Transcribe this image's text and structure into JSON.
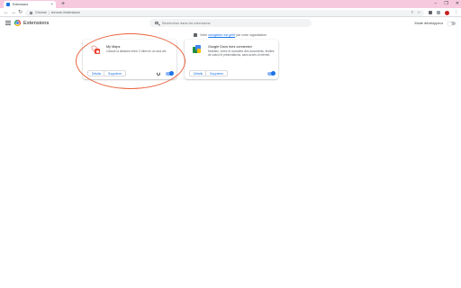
{
  "browser": {
    "tab_title": "Extensions",
    "tab_close": "×",
    "new_tab": "+",
    "window_controls": [
      "–",
      "❐",
      "✕"
    ],
    "omnibox": {
      "site_label": "Chrome",
      "separator": "|",
      "url": "chrome://extensions"
    }
  },
  "header": {
    "title": "Extensions",
    "search_placeholder": "Rechercher dans les extensions",
    "developer_mode_label": "Mode développeur",
    "developer_mode_on": false
  },
  "managed_notice": {
    "before": "Votre",
    "link": "navigateur est géré",
    "after": "par votre organisation"
  },
  "extensions": [
    {
      "name": "My Maps",
      "description": "Calcule la distance entre 2 villes en un seul clic",
      "details_label": "Détails",
      "remove_label": "Supprimer",
      "enabled": true,
      "icon": "map-pin-icon"
    },
    {
      "name": "Google Docs hors connexion",
      "description": "Modifiez, créez et consultez des documents, feuilles de calcul et présentations, sans accès à Internet.",
      "details_label": "Détails",
      "remove_label": "Supprimer",
      "enabled": true,
      "icon": "google-docs-icon"
    }
  ],
  "colors": {
    "accent": "#1a73e8",
    "tabstrip": "#f6c9de",
    "annotation": "#e8643c"
  }
}
